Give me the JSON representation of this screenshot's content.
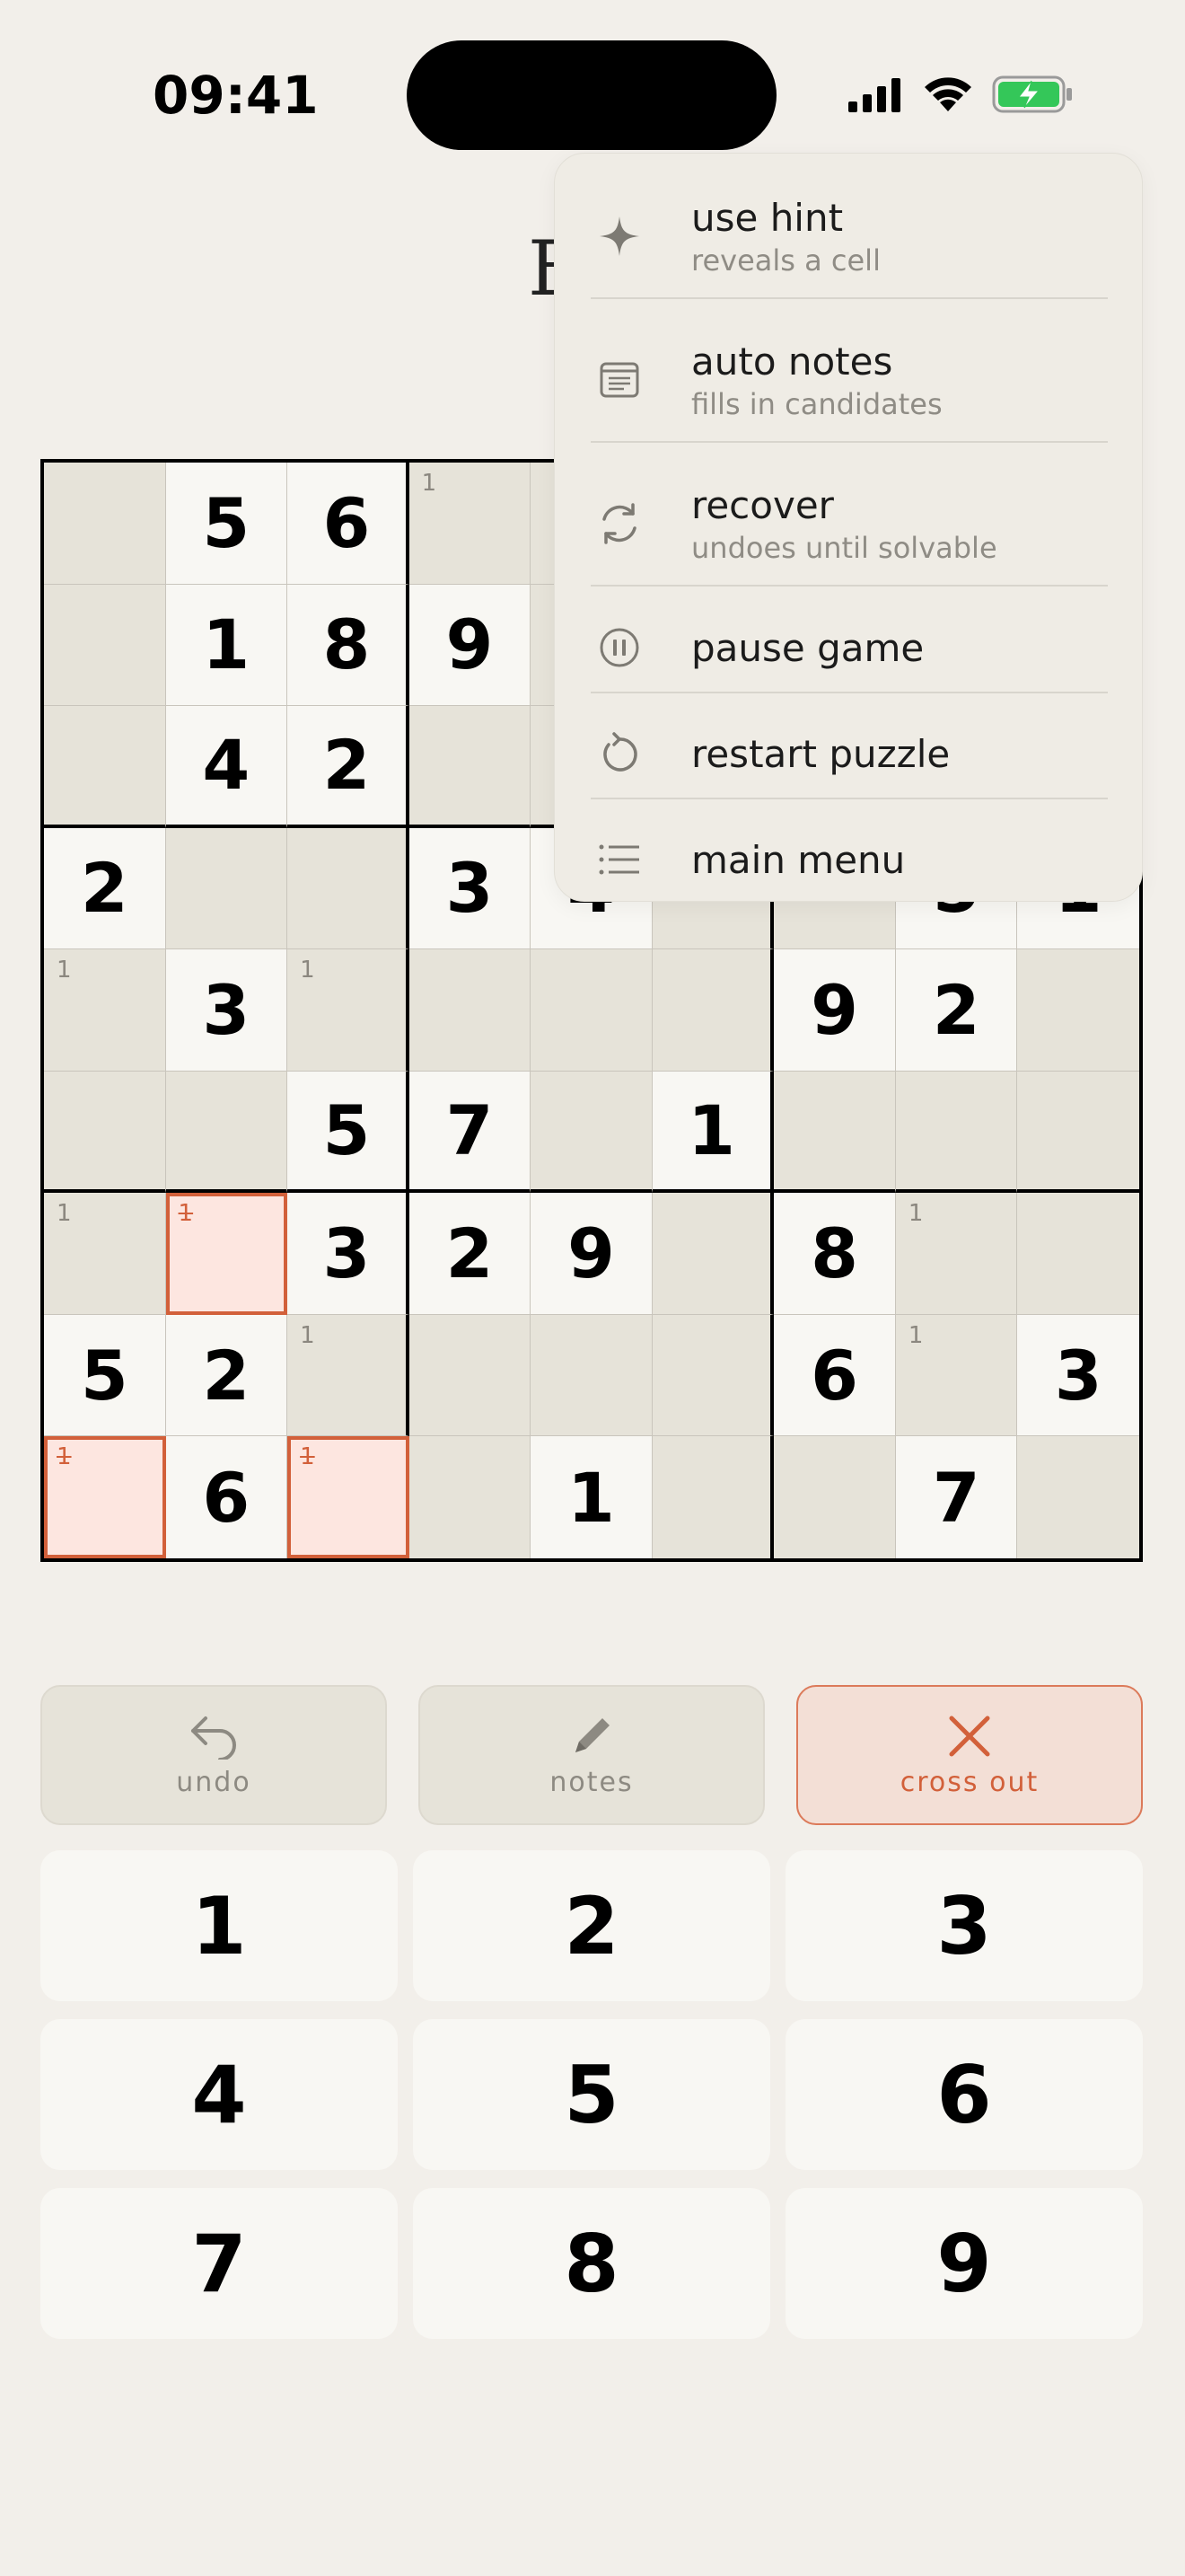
{
  "status": {
    "time": "09:41"
  },
  "title": "E",
  "board": [
    [
      {
        "t": "e"
      },
      {
        "t": "g",
        "v": "5"
      },
      {
        "t": "g",
        "v": "6"
      },
      {
        "t": "e",
        "n": "1"
      },
      {
        "t": "e"
      },
      {
        "t": "e"
      },
      {
        "t": "e"
      },
      {
        "t": "e"
      },
      {
        "t": "e"
      }
    ],
    [
      {
        "t": "e"
      },
      {
        "t": "g",
        "v": "1"
      },
      {
        "t": "g",
        "v": "8"
      },
      {
        "t": "g",
        "v": "9"
      },
      {
        "t": "e"
      },
      {
        "t": "e"
      },
      {
        "t": "e"
      },
      {
        "t": "e"
      },
      {
        "t": "e"
      }
    ],
    [
      {
        "t": "e"
      },
      {
        "t": "g",
        "v": "4"
      },
      {
        "t": "g",
        "v": "2"
      },
      {
        "t": "e"
      },
      {
        "t": "e"
      },
      {
        "t": "e"
      },
      {
        "t": "e"
      },
      {
        "t": "e"
      },
      {
        "t": "e"
      }
    ],
    [
      {
        "t": "g",
        "v": "2"
      },
      {
        "t": "e"
      },
      {
        "t": "e"
      },
      {
        "t": "g",
        "v": "3"
      },
      {
        "t": "g",
        "v": "4"
      },
      {
        "t": "e"
      },
      {
        "t": "e"
      },
      {
        "t": "g",
        "v": "5"
      },
      {
        "t": "g",
        "v": "1"
      }
    ],
    [
      {
        "t": "e",
        "n": "1"
      },
      {
        "t": "g",
        "v": "3"
      },
      {
        "t": "e",
        "n": "1"
      },
      {
        "t": "e"
      },
      {
        "t": "e"
      },
      {
        "t": "e"
      },
      {
        "t": "g",
        "v": "9"
      },
      {
        "t": "g",
        "v": "2"
      },
      {
        "t": "e"
      }
    ],
    [
      {
        "t": "e"
      },
      {
        "t": "e"
      },
      {
        "t": "g",
        "v": "5"
      },
      {
        "t": "g",
        "v": "7"
      },
      {
        "t": "e"
      },
      {
        "t": "g",
        "v": "1"
      },
      {
        "t": "e"
      },
      {
        "t": "e"
      },
      {
        "t": "e"
      }
    ],
    [
      {
        "t": "e",
        "n": "1"
      },
      {
        "t": "c",
        "n": "1"
      },
      {
        "t": "g",
        "v": "3"
      },
      {
        "t": "g",
        "v": "2"
      },
      {
        "t": "g",
        "v": "9"
      },
      {
        "t": "e"
      },
      {
        "t": "g",
        "v": "8"
      },
      {
        "t": "e",
        "n": "1"
      },
      {
        "t": "e"
      }
    ],
    [
      {
        "t": "g",
        "v": "5"
      },
      {
        "t": "g",
        "v": "2"
      },
      {
        "t": "e",
        "n": "1"
      },
      {
        "t": "e"
      },
      {
        "t": "e"
      },
      {
        "t": "e"
      },
      {
        "t": "g",
        "v": "6"
      },
      {
        "t": "e",
        "n": "1"
      },
      {
        "t": "g",
        "v": "3"
      }
    ],
    [
      {
        "t": "c",
        "n": "1"
      },
      {
        "t": "g",
        "v": "6"
      },
      {
        "t": "c",
        "n": "1"
      },
      {
        "t": "e"
      },
      {
        "t": "g",
        "v": "1"
      },
      {
        "t": "e"
      },
      {
        "t": "e"
      },
      {
        "t": "g",
        "v": "7"
      },
      {
        "t": "e"
      }
    ]
  ],
  "tools": {
    "undo": "undo",
    "notes": "notes",
    "cross_out": "cross out"
  },
  "keypad": [
    "1",
    "2",
    "3",
    "4",
    "5",
    "6",
    "7",
    "8",
    "9"
  ],
  "menu": {
    "hint": {
      "label": "use hint",
      "sub": "reveals a cell"
    },
    "auto_notes": {
      "label": "auto notes",
      "sub": "fills in candidates"
    },
    "recover": {
      "label": "recover",
      "sub": "undoes until solvable"
    },
    "pause": {
      "label": "pause game"
    },
    "restart": {
      "label": "restart puzzle"
    },
    "main_menu": {
      "label": "main menu"
    }
  },
  "colors": {
    "accent": "#d2603a",
    "background": "#f2efea",
    "battery": "#34c759"
  }
}
